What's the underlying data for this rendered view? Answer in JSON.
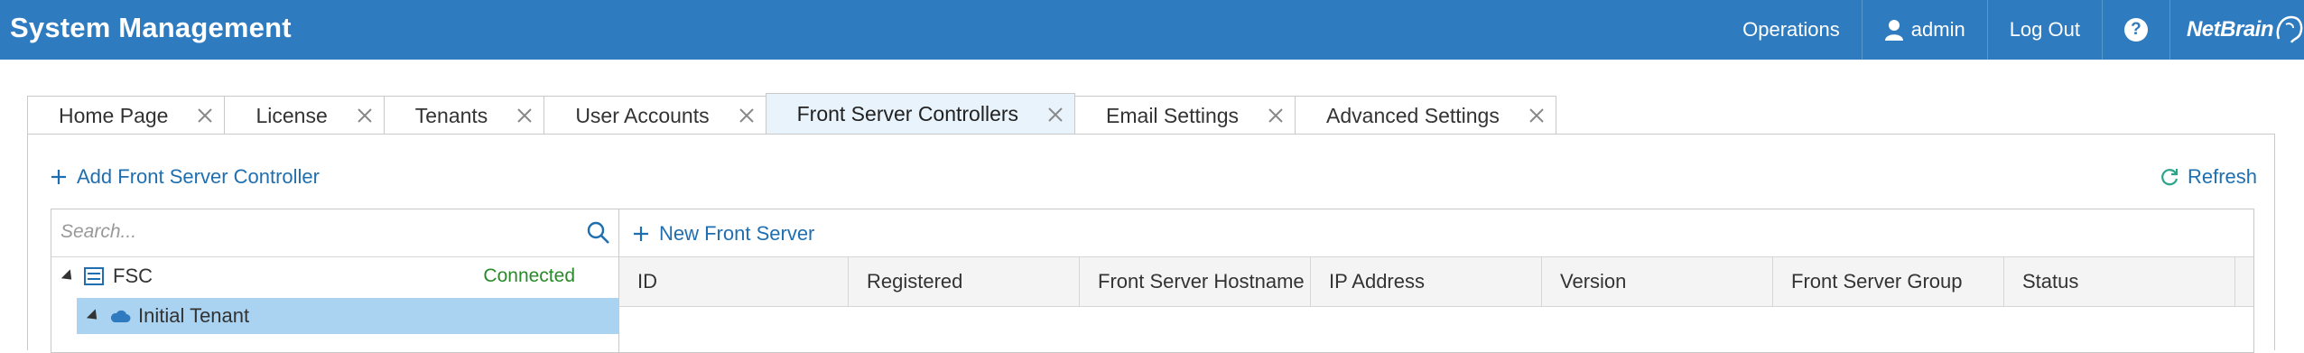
{
  "header": {
    "app_title": "System Management",
    "nav": {
      "operations": "Operations",
      "user": "admin",
      "logout": "Log Out",
      "help": "?",
      "logo_text": "NetBrain"
    }
  },
  "tabs": [
    {
      "label": "Home Page",
      "active": false
    },
    {
      "label": "License",
      "active": false
    },
    {
      "label": "Tenants",
      "active": false
    },
    {
      "label": "User Accounts",
      "active": false
    },
    {
      "label": "Front Server Controllers",
      "active": true
    },
    {
      "label": "Email Settings",
      "active": false
    },
    {
      "label": "Advanced Settings",
      "active": false
    }
  ],
  "toolbar": {
    "add_fsc": "Add Front Server Controller",
    "refresh": "Refresh"
  },
  "tree": {
    "search_placeholder": "Search...",
    "fsc_label": "FSC",
    "fsc_status": "Connected",
    "tenant_label": "Initial Tenant"
  },
  "grid": {
    "new_front_server": "New Front Server",
    "columns": [
      "ID",
      "Registered",
      "Front Server Hostname",
      "IP Address",
      "Version",
      "Front Server Group",
      "Status"
    ]
  },
  "colors": {
    "header_bg": "#2f7bbf",
    "link": "#1f6fb0",
    "selected_row": "#a9d3f1",
    "connected": "#2a8a2a"
  }
}
